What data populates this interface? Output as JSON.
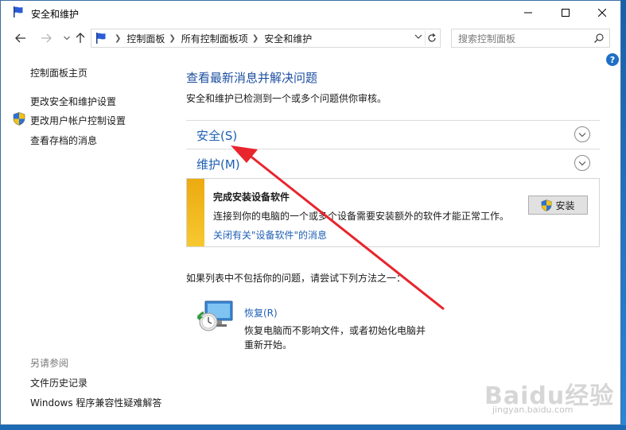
{
  "window": {
    "title": "安全和维护"
  },
  "address_bar": {
    "crumbs": [
      "控制面板",
      "所有控制面板项",
      "安全和维护"
    ],
    "search_placeholder": "搜索控制面板"
  },
  "left_pane": {
    "home_link": "控制面板主页",
    "links": [
      "更改安全和维护设置",
      "更改用户帐户控制设置",
      "查看存档的消息"
    ],
    "see_also_label": "另请参阅",
    "see_also_links": [
      "文件历史记录",
      "Windows 程序兼容性疑难解答"
    ]
  },
  "main": {
    "title": "查看最新消息并解决问题",
    "subtitle": "安全和维护已检测到一个或多个问题供你审核。",
    "sections": [
      {
        "label": "安全(S)"
      },
      {
        "label": "维护(M)"
      }
    ],
    "alert": {
      "title": "完成安装设备软件",
      "description": "连接到你的电脑的一个或多个设备需要安装额外的软件才能正常工作。",
      "link": "关闭有关\"设备软件\"的消息",
      "button_label": "安装"
    },
    "hint": "如果列表中不包括你的问题，请尝试下列方法之一：",
    "recovery": {
      "title": "恢复(R)",
      "description": "恢复电脑而不影响文件，或者初始化电脑并重新开始。"
    }
  },
  "watermark": {
    "text": "Baidu经验",
    "url": "jingyan.baidu.com"
  },
  "colors": {
    "link_blue": "#1e5fb5",
    "title_blue": "#1e4fa0",
    "alert_yellow": "#f2b818",
    "annotation_red": "#e8242c"
  }
}
